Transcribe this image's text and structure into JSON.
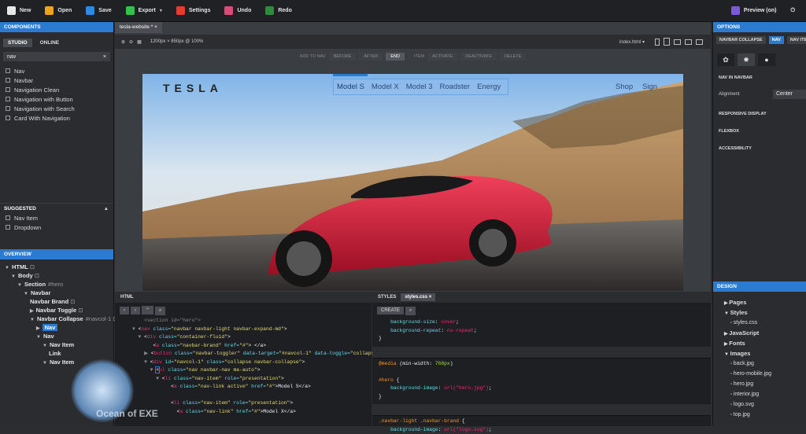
{
  "toolbar": {
    "items": [
      {
        "label": "New",
        "color": "#e8e8e8"
      },
      {
        "label": "Open",
        "color": "#f0a21b"
      },
      {
        "label": "Save",
        "color": "#2d8be8"
      },
      {
        "label": "Export",
        "color": "#33c24d",
        "caret": true
      },
      {
        "label": "Settings",
        "color": "#e83a2d"
      },
      {
        "label": "Undo",
        "color": "#d94c79"
      },
      {
        "label": "Redo",
        "color": "#2e8b3b"
      }
    ],
    "preview_label": "Preview (on)",
    "preview_color": "#7a5ad8"
  },
  "left": {
    "components_title": "COMPONENTS",
    "tabs": [
      "STUDIO",
      "ONLINE"
    ],
    "search_value": "nav",
    "search_clear": "×",
    "results": [
      "Nav",
      "Navbar",
      "Navigation Clean",
      "Navigation with Button",
      "Navigation with Search",
      "Card With Navigation"
    ],
    "suggested_title": "SUGGESTED",
    "suggested": [
      "Nav Item",
      "Dropdown"
    ],
    "overview_title": "OVERVIEW",
    "tree": [
      {
        "label": "HTML",
        "depth": 0,
        "arrow": "▼",
        "lock": true
      },
      {
        "label": "Body",
        "depth": 1,
        "arrow": "▼",
        "lock": true
      },
      {
        "label": "Section",
        "depth": 2,
        "arrow": "▼",
        "meta": "#hero"
      },
      {
        "label": "Navbar",
        "depth": 3,
        "arrow": "▼"
      },
      {
        "label": "Navbar Brand",
        "depth": 4,
        "arrow": "",
        "lock": true
      },
      {
        "label": "Navbar Toggle",
        "depth": 4,
        "arrow": "▶",
        "lock": true
      },
      {
        "label": "Navbar Collapse",
        "depth": 4,
        "arrow": "▼",
        "meta": "#navcol-1",
        "lock": true
      },
      {
        "label": "Nav",
        "depth": 5,
        "arrow": "▶",
        "selected": true
      },
      {
        "label": "Nav",
        "depth": 5,
        "arrow": "▼"
      },
      {
        "label": "Nav Item",
        "depth": 6,
        "arrow": "▼"
      },
      {
        "label": "Link",
        "depth": 7,
        "arrow": ""
      },
      {
        "label": "Nav Item",
        "depth": 6,
        "arrow": "▼"
      }
    ]
  },
  "doc_tab": "tesla-website *",
  "canvas": {
    "size_label": "1200px × 850px @ 100%",
    "file": "index.html",
    "nav_controls": {
      "add_to_nav": "ADD TO NAV",
      "before": "BEFORE",
      "after": "AFTER",
      "end": "END",
      "item": "ITEM",
      "activate": "ACTIVATE",
      "deactivate": "DEACTIVATE",
      "delete": "DELETE"
    },
    "site": {
      "logo": "TESLA",
      "menu": [
        "Model S",
        "Model X",
        "Model 3",
        "Roadster",
        "Energy"
      ],
      "shop": "Shop",
      "sign": "Sign"
    }
  },
  "right": {
    "options_title": "OPTIONS",
    "chips": [
      "NAVBAR COLLAPSE",
      "NAV",
      "NAV ITEM"
    ],
    "section_nav": "NAV IN NAVBAR",
    "alignment_label": "Alignment",
    "alignment_value": "Center",
    "sections": [
      "RESPONSIVE DISPLAY",
      "FLEXBOX",
      "ACCESSIBILITY"
    ],
    "design_title": "DESIGN",
    "design": [
      {
        "label": "Pages",
        "arrow": "▶"
      },
      {
        "label": "Styles",
        "arrow": "▼"
      },
      {
        "label": "styles.css",
        "file": true
      },
      {
        "label": "JavaScript",
        "arrow": "▶"
      },
      {
        "label": "Fonts",
        "arrow": "▶"
      },
      {
        "label": "Images",
        "arrow": "▼"
      },
      {
        "label": "back.jpg",
        "file": true
      },
      {
        "label": "hero-mobile.jpg",
        "file": true
      },
      {
        "label": "hero.jpg",
        "file": true
      },
      {
        "label": "interior.jpg",
        "file": true
      },
      {
        "label": "logo.svg",
        "file": true
      },
      {
        "label": "top.jpg",
        "file": true
      }
    ]
  },
  "html_panel": {
    "title": "HTML"
  },
  "css_panel": {
    "title": "STYLES",
    "file_tab": "styles.css",
    "create": "CREATE"
  },
  "watermark": "Ocean of EXE"
}
